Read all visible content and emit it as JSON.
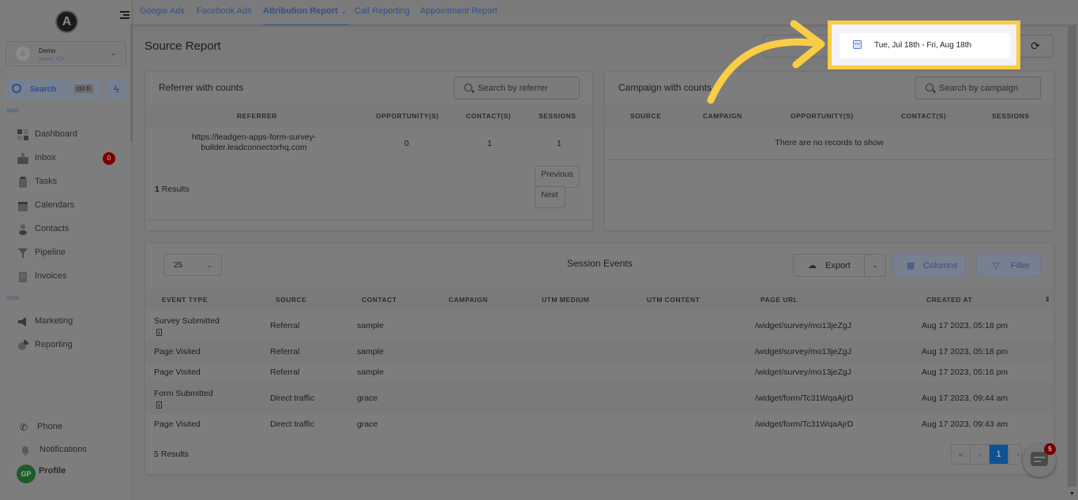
{
  "sidebar": {
    "logo_letter": "A",
    "location": {
      "name": "Demo",
      "city": "Irvine, CA"
    },
    "search": {
      "label": "Search",
      "shortcut": "ctrl K"
    },
    "sections": {
      "apps": "Apps",
      "tools": "Tools"
    },
    "apps": [
      {
        "label": "Dashboard",
        "icon": "dashboard-icon"
      },
      {
        "label": "Inbox",
        "icon": "inbox-icon",
        "badge": "0"
      },
      {
        "label": "Tasks",
        "icon": "tasks-icon"
      },
      {
        "label": "Calendars",
        "icon": "calendar-icon"
      },
      {
        "label": "Contacts",
        "icon": "contacts-icon"
      },
      {
        "label": "Pipeline",
        "icon": "pipeline-icon"
      },
      {
        "label": "Invoices",
        "icon": "invoices-icon"
      }
    ],
    "tools": [
      {
        "label": "Marketing",
        "icon": "megaphone-icon"
      },
      {
        "label": "Reporting",
        "icon": "pie-chart-icon"
      }
    ],
    "bottom": {
      "phone": "Phone",
      "notifications": "Notifications",
      "profile": "Profile",
      "profile_initials": "GP"
    }
  },
  "tabs": [
    {
      "label": "Google Ads",
      "active": false
    },
    {
      "label": "Facebook Ads",
      "active": false
    },
    {
      "label": "Attribution Report",
      "active": true,
      "dropdown": true
    },
    {
      "label": "Call Reporting",
      "active": false
    },
    {
      "label": "Appointment Report",
      "active": false
    }
  ],
  "page": {
    "title": "Source Report",
    "date_range": "Tue, Jul 18th - Fri, Aug 18th"
  },
  "referrer_card": {
    "title": "Referrer with counts",
    "search_placeholder": "Search by referrer",
    "columns": [
      "REFERRER",
      "OPPORTUNITY(S)",
      "CONTACT(S)",
      "SESSIONS"
    ],
    "rows": [
      {
        "referrer": "https://leadgen-apps-form-survey-builder.leadconnectorhq.com",
        "opportunities": "0",
        "contacts": "1",
        "sessions": "1"
      }
    ],
    "results_count": "1",
    "results_label": "Results",
    "previous_label": "Previous",
    "next_label": "Next"
  },
  "campaign_card": {
    "title": "Campaign with counts",
    "search_placeholder": "Search by campaign",
    "columns": [
      "SOURCE",
      "CAMPAIGN",
      "OPPORTUNITY(S)",
      "CONTACT(S)",
      "SESSIONS"
    ],
    "empty_message": "There are no records to show"
  },
  "events_card": {
    "per_page": "25",
    "title": "Session Events",
    "export_label": "Export",
    "columns_label": "Columns",
    "filter_label": "Filter",
    "columns": [
      "EVENT TYPE",
      "SOURCE",
      "CONTACT",
      "CAMPAIGN",
      "UTM MEDIUM",
      "UTM CONTENT",
      "PAGE URL",
      "CREATED AT"
    ],
    "rows": [
      {
        "event_type": "Survey Submitted",
        "has_doc": true,
        "source": "Referral",
        "contact": "sample",
        "page_url": "/widget/survey/mo13jeZgJ",
        "created_at": "Aug 17 2023, 05:18 pm"
      },
      {
        "event_type": "Page Visited",
        "has_doc": false,
        "source": "Referral",
        "contact": "sample",
        "page_url": "/widget/survey/mo13jeZgJ",
        "created_at": "Aug 17 2023, 05:18 pm"
      },
      {
        "event_type": "Page Visited",
        "has_doc": false,
        "source": "Referral",
        "contact": "sample",
        "page_url": "/widget/survey/mo13jeZgJ",
        "created_at": "Aug 17 2023, 05:16 pm"
      },
      {
        "event_type": "Form Submitted",
        "has_doc": true,
        "source": "Direct traffic",
        "contact": "grace",
        "page_url": "/widget/form/Tc31WqaAjrD",
        "created_at": "Aug 17 2023, 09:44 am"
      },
      {
        "event_type": "Page Visited",
        "has_doc": false,
        "source": "Direct traffic",
        "contact": "grace",
        "page_url": "/widget/form/Tc31WqaAjrD",
        "created_at": "Aug 17 2023, 09:43 am"
      }
    ],
    "results_count": "5",
    "results_label": "Results",
    "pagination": {
      "first": "«",
      "prev": "‹",
      "current": "1",
      "next": "›"
    }
  },
  "chat_widget": {
    "badge": "5"
  },
  "colors": {
    "highlight": "#f9cd45",
    "accent": "#32508a",
    "active_page": "#0d5293",
    "badge": "#7a0000"
  }
}
